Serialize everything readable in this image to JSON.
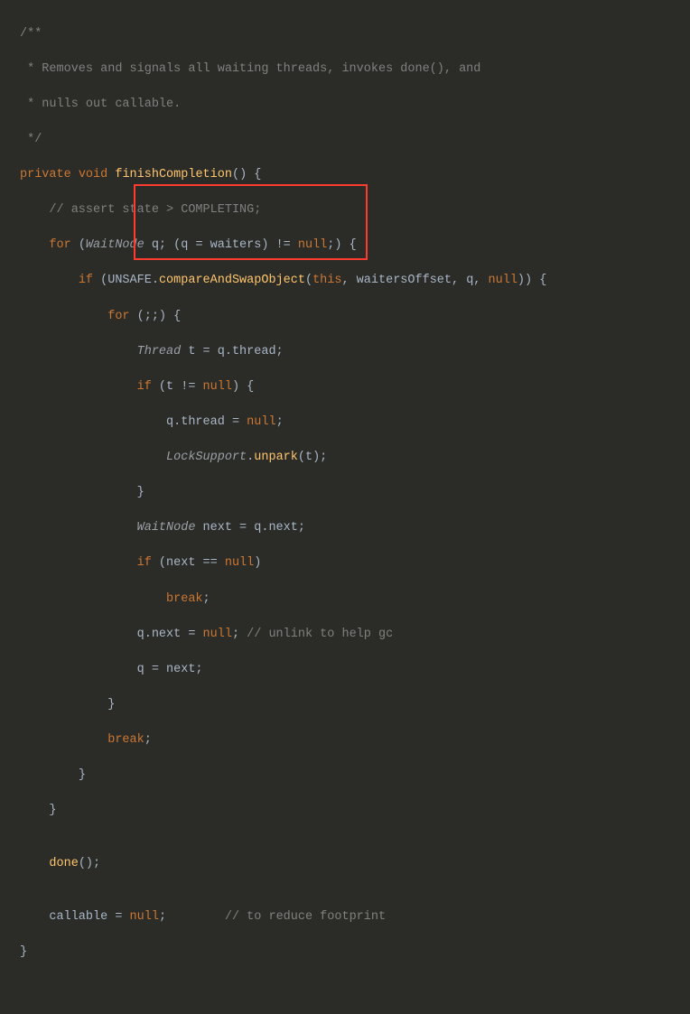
{
  "comment1": "/**",
  "comment2": " * Removes and signals all waiting threads, invokes done(), and",
  "comment3": " * nulls out callable.",
  "comment4": " */",
  "l5_private": "private",
  "l5_void": "void",
  "l5_method": "finishCompletion",
  "l5_rest": "() {",
  "l6": "    // assert state > COMPLETING;",
  "l7_for": "for",
  "l7_open": " (",
  "l7_type": "WaitNode",
  "l7_rest1": " q; (q = waiters) != ",
  "l7_null": "null",
  "l7_rest2": ";) {",
  "l8_if": "if",
  "l8_open": " (UNSAFE.",
  "l8_method": "compareAndSwapObject",
  "l8_open2": "(",
  "l8_this": "this",
  "l8_args": ", waitersOffset, q, ",
  "l8_null": "null",
  "l8_close": ")) {",
  "l9_for": "for",
  "l9_rest": " (;;) {",
  "l10_type": "Thread",
  "l10_rest": " t = q.thread;",
  "l11_if": "if",
  "l11_rest1": " (t != ",
  "l11_null": "null",
  "l11_rest2": ") {",
  "l12_body": "q.thread = ",
  "l12_null": "null",
  "l12_semi": ";",
  "l13_type": "LockSupport",
  "l13_dot": ".",
  "l13_method": "unpark",
  "l13_args": "(t);",
  "l14": "}",
  "l15_type": "WaitNode",
  "l15_rest": " next = q.next;",
  "l16_if": "if",
  "l16_rest1": " (next == ",
  "l16_null": "null",
  "l16_rest2": ")",
  "l17_break": "break",
  "l17_semi": ";",
  "l18_body": "q.next = ",
  "l18_null": "null",
  "l18_semi": "; ",
  "l18_comment": "// unlink to help gc",
  "l19": "q = next;",
  "l20": "}",
  "l21_break": "break",
  "l21_semi": ";",
  "l22": "}",
  "l23": "}",
  "l24": "",
  "l25_method": "done",
  "l25_rest": "();",
  "l26": "",
  "l27_body": "callable = ",
  "l27_null": "null",
  "l27_semi": ";        ",
  "l27_comment": "// to reduce footprint",
  "l28": "}",
  "ind1": "    ",
  "ind2": "        ",
  "ind3": "            ",
  "ind4": "                ",
  "ind5": "                    ",
  "ind6": "                        "
}
